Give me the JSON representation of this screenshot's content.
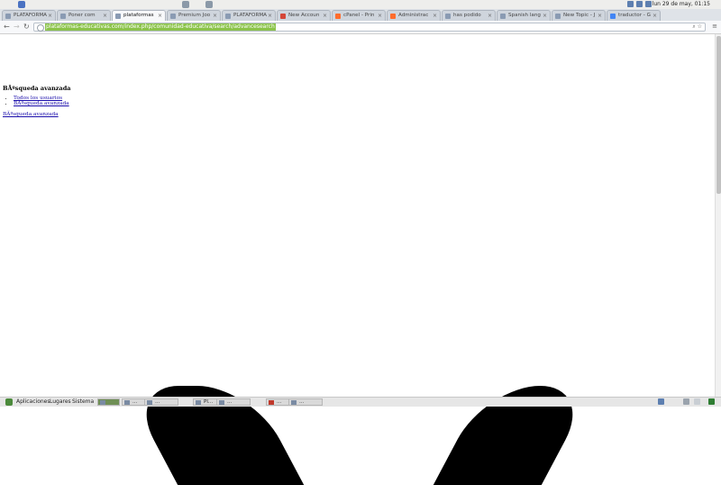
{
  "top_panel": {
    "clock": "lun 29 de may, 01:15"
  },
  "tabs": [
    {
      "label": "PLATAFORMA",
      "active": false
    },
    {
      "label": "Poner com",
      "active": false
    },
    {
      "label": "plataformas",
      "active": true
    },
    {
      "label": "Premium Joo",
      "active": false
    },
    {
      "label": "PLATAFORMA",
      "active": false
    },
    {
      "label": "New Accoun",
      "active": false
    },
    {
      "label": "cPanel - Prin",
      "active": false
    },
    {
      "label": "Administrac",
      "active": false
    },
    {
      "label": "has podido",
      "active": false
    },
    {
      "label": "Spanish lang",
      "active": false
    },
    {
      "label": "New Topic - J",
      "active": false
    },
    {
      "label": "traductor - G",
      "active": false
    }
  ],
  "toolbar": {
    "back_label": "←",
    "forward_label": "→",
    "reload_label": "↻",
    "url": "plataformas-educativas.com/index.php/comunidad-educativa/search/advancesearch",
    "search_glyph": "⌕",
    "star_glyph": "☆",
    "menu_glyph": "≡"
  },
  "page": {
    "heading": "BÃºsqueda avanzada",
    "links": [
      "Todos los usuarios",
      "BÃºsqueda avanzada"
    ],
    "bottom_link": "BÃºsqueda avanzada"
  },
  "bottom_panel": {
    "menus": [
      "Aplicaciones",
      "Lugares",
      "Sistema"
    ],
    "tasks": [
      "",
      "...",
      "...",
      "Pl...",
      "...",
      "...",
      "..."
    ]
  }
}
